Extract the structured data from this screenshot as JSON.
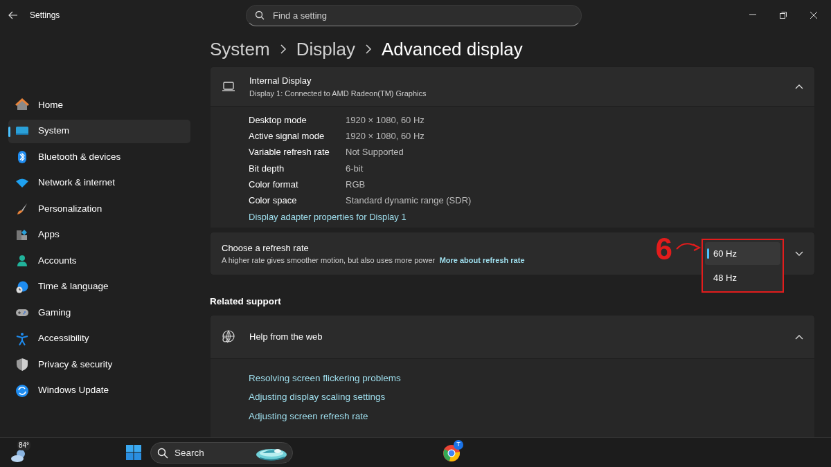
{
  "window": {
    "title": "Settings"
  },
  "search": {
    "placeholder": "Find a setting"
  },
  "breadcrumb": [
    {
      "label": "System"
    },
    {
      "label": "Display"
    },
    {
      "label": "Advanced display"
    }
  ],
  "sidebar": {
    "items": [
      {
        "label": "Home",
        "kind": "home",
        "selected": false
      },
      {
        "label": "System",
        "kind": "system",
        "selected": true
      },
      {
        "label": "Bluetooth & devices",
        "kind": "bluetooth",
        "selected": false
      },
      {
        "label": "Network & internet",
        "kind": "wifi",
        "selected": false
      },
      {
        "label": "Personalization",
        "kind": "brush",
        "selected": false
      },
      {
        "label": "Apps",
        "kind": "apps",
        "selected": false
      },
      {
        "label": "Accounts",
        "kind": "person",
        "selected": false
      },
      {
        "label": "Time & language",
        "kind": "globe",
        "selected": false
      },
      {
        "label": "Gaming",
        "kind": "gamepad",
        "selected": false
      },
      {
        "label": "Accessibility",
        "kind": "access",
        "selected": false
      },
      {
        "label": "Privacy & security",
        "kind": "shield",
        "selected": false
      },
      {
        "label": "Windows Update",
        "kind": "update",
        "selected": false
      }
    ]
  },
  "display_card": {
    "title": "Internal Display",
    "subtitle": "Display 1: Connected to AMD Radeon(TM) Graphics",
    "expanded": true,
    "rows": [
      {
        "label": "Desktop mode",
        "value": "1920 × 1080, 60 Hz"
      },
      {
        "label": "Active signal mode",
        "value": "1920 × 1080, 60 Hz"
      },
      {
        "label": "Variable refresh rate",
        "value": "Not Supported"
      },
      {
        "label": "Bit depth",
        "value": "6-bit"
      },
      {
        "label": "Color format",
        "value": "RGB"
      },
      {
        "label": "Color space",
        "value": "Standard dynamic range (SDR)"
      }
    ],
    "link": "Display adapter properties for Display 1"
  },
  "refresh_card": {
    "title": "Choose a refresh rate",
    "description": "A higher rate gives smoother motion, but also uses more power",
    "link": "More about refresh rate",
    "dropdown": {
      "expanded": true,
      "options": [
        {
          "label": "60 Hz",
          "selected": true
        },
        {
          "label": "48 Hz",
          "selected": false
        }
      ]
    }
  },
  "annotation": {
    "number": "6"
  },
  "related_support": {
    "heading": "Related support",
    "card": {
      "title": "Help from the web",
      "expanded": true,
      "links": [
        "Resolving screen flickering problems",
        "Adjusting display scaling settings",
        "Adjusting screen refresh rate"
      ]
    }
  },
  "taskbar": {
    "weather": "84°",
    "search": {
      "placeholder": "Search"
    },
    "browser_badge": "T"
  }
}
